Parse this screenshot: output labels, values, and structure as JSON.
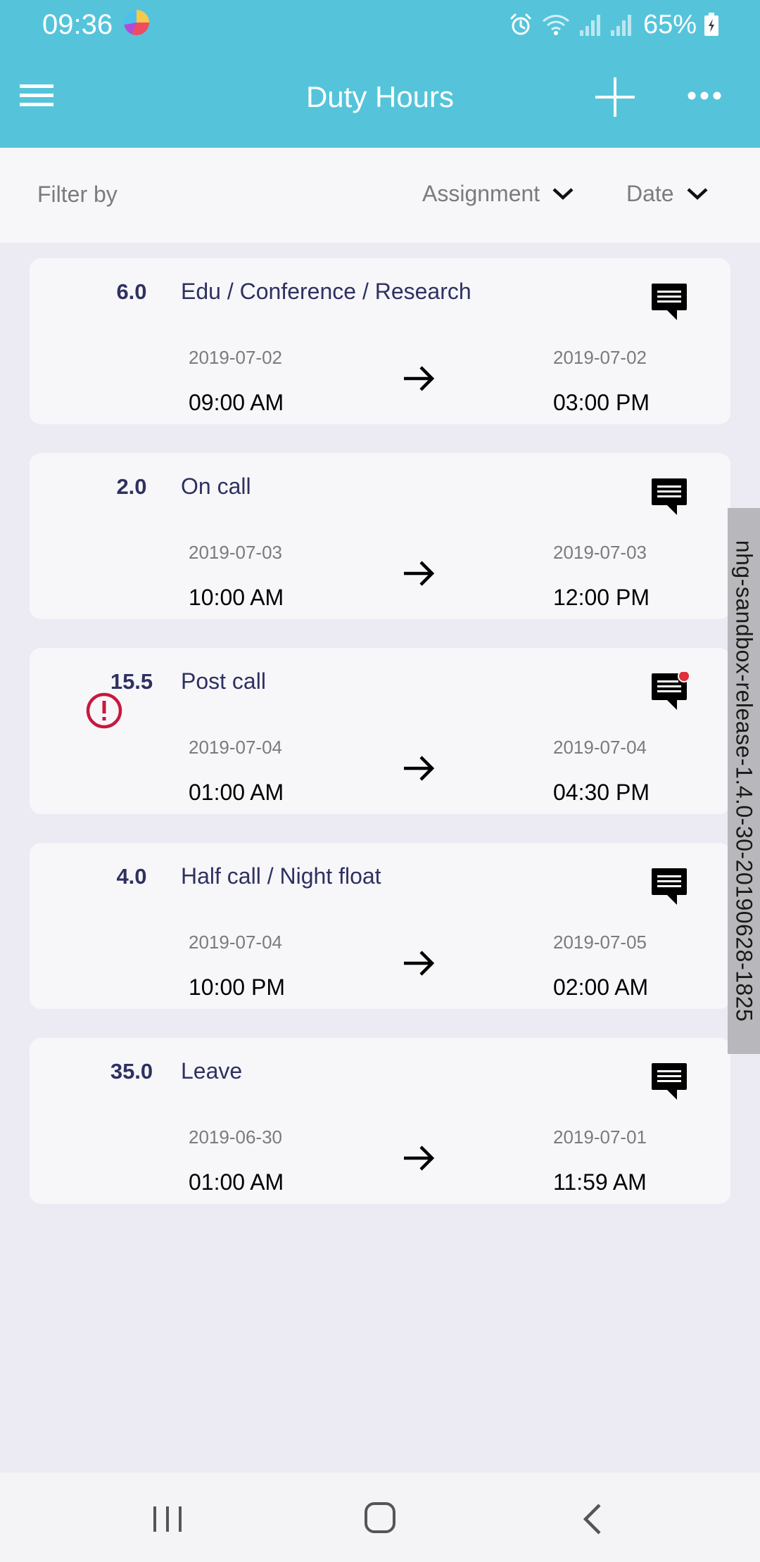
{
  "status_bar": {
    "time": "09:36",
    "battery": "65%",
    "icons": [
      "app-icon",
      "alarm-icon",
      "wifi-icon",
      "signal-icon",
      "signal-icon",
      "battery-charging-icon"
    ]
  },
  "header": {
    "title": "Duty Hours",
    "menu_icon": "hamburger-menu-icon",
    "add_icon": "plus-icon",
    "more_icon": "more-horizontal-icon",
    "background": "#55c4da"
  },
  "filter": {
    "label": "Filter by",
    "assignment": "Assignment",
    "date": "Date"
  },
  "entries": [
    {
      "hours": "6.0",
      "title": "Edu / Conference / Research",
      "start_date": "2019-07-02",
      "start_time": "09:00 AM",
      "end_date": "2019-07-02",
      "end_time": "03:00 PM",
      "warning": false,
      "unread_comment": false
    },
    {
      "hours": "2.0",
      "title": "On call",
      "start_date": "2019-07-03",
      "start_time": "10:00 AM",
      "end_date": "2019-07-03",
      "end_time": "12:00 PM",
      "warning": false,
      "unread_comment": false
    },
    {
      "hours": "15.5",
      "title": "Post call",
      "start_date": "2019-07-04",
      "start_time": "01:00 AM",
      "end_date": "2019-07-04",
      "end_time": "04:30 PM",
      "warning": true,
      "unread_comment": true
    },
    {
      "hours": "4.0",
      "title": "Half call / Night float",
      "start_date": "2019-07-04",
      "start_time": "10:00 PM",
      "end_date": "2019-07-05",
      "end_time": "02:00 AM",
      "warning": false,
      "unread_comment": false
    },
    {
      "hours": "35.0",
      "title": "Leave",
      "start_date": "2019-06-30",
      "start_time": "01:00 AM",
      "end_date": "2019-07-01",
      "end_time": "11:59 AM",
      "warning": false,
      "unread_comment": false
    }
  ],
  "side_tab": {
    "text": "nhg-sandbox-release-1.4.0-30-20190628-1825"
  },
  "nav": {
    "recent_icon": "recent-apps-icon",
    "home_icon": "home-icon",
    "back_icon": "back-icon"
  },
  "colors": {
    "header": "#55c4da",
    "title_text": "#2e3160",
    "warning": "#c8193c",
    "unread_dot": "#e0303a"
  }
}
